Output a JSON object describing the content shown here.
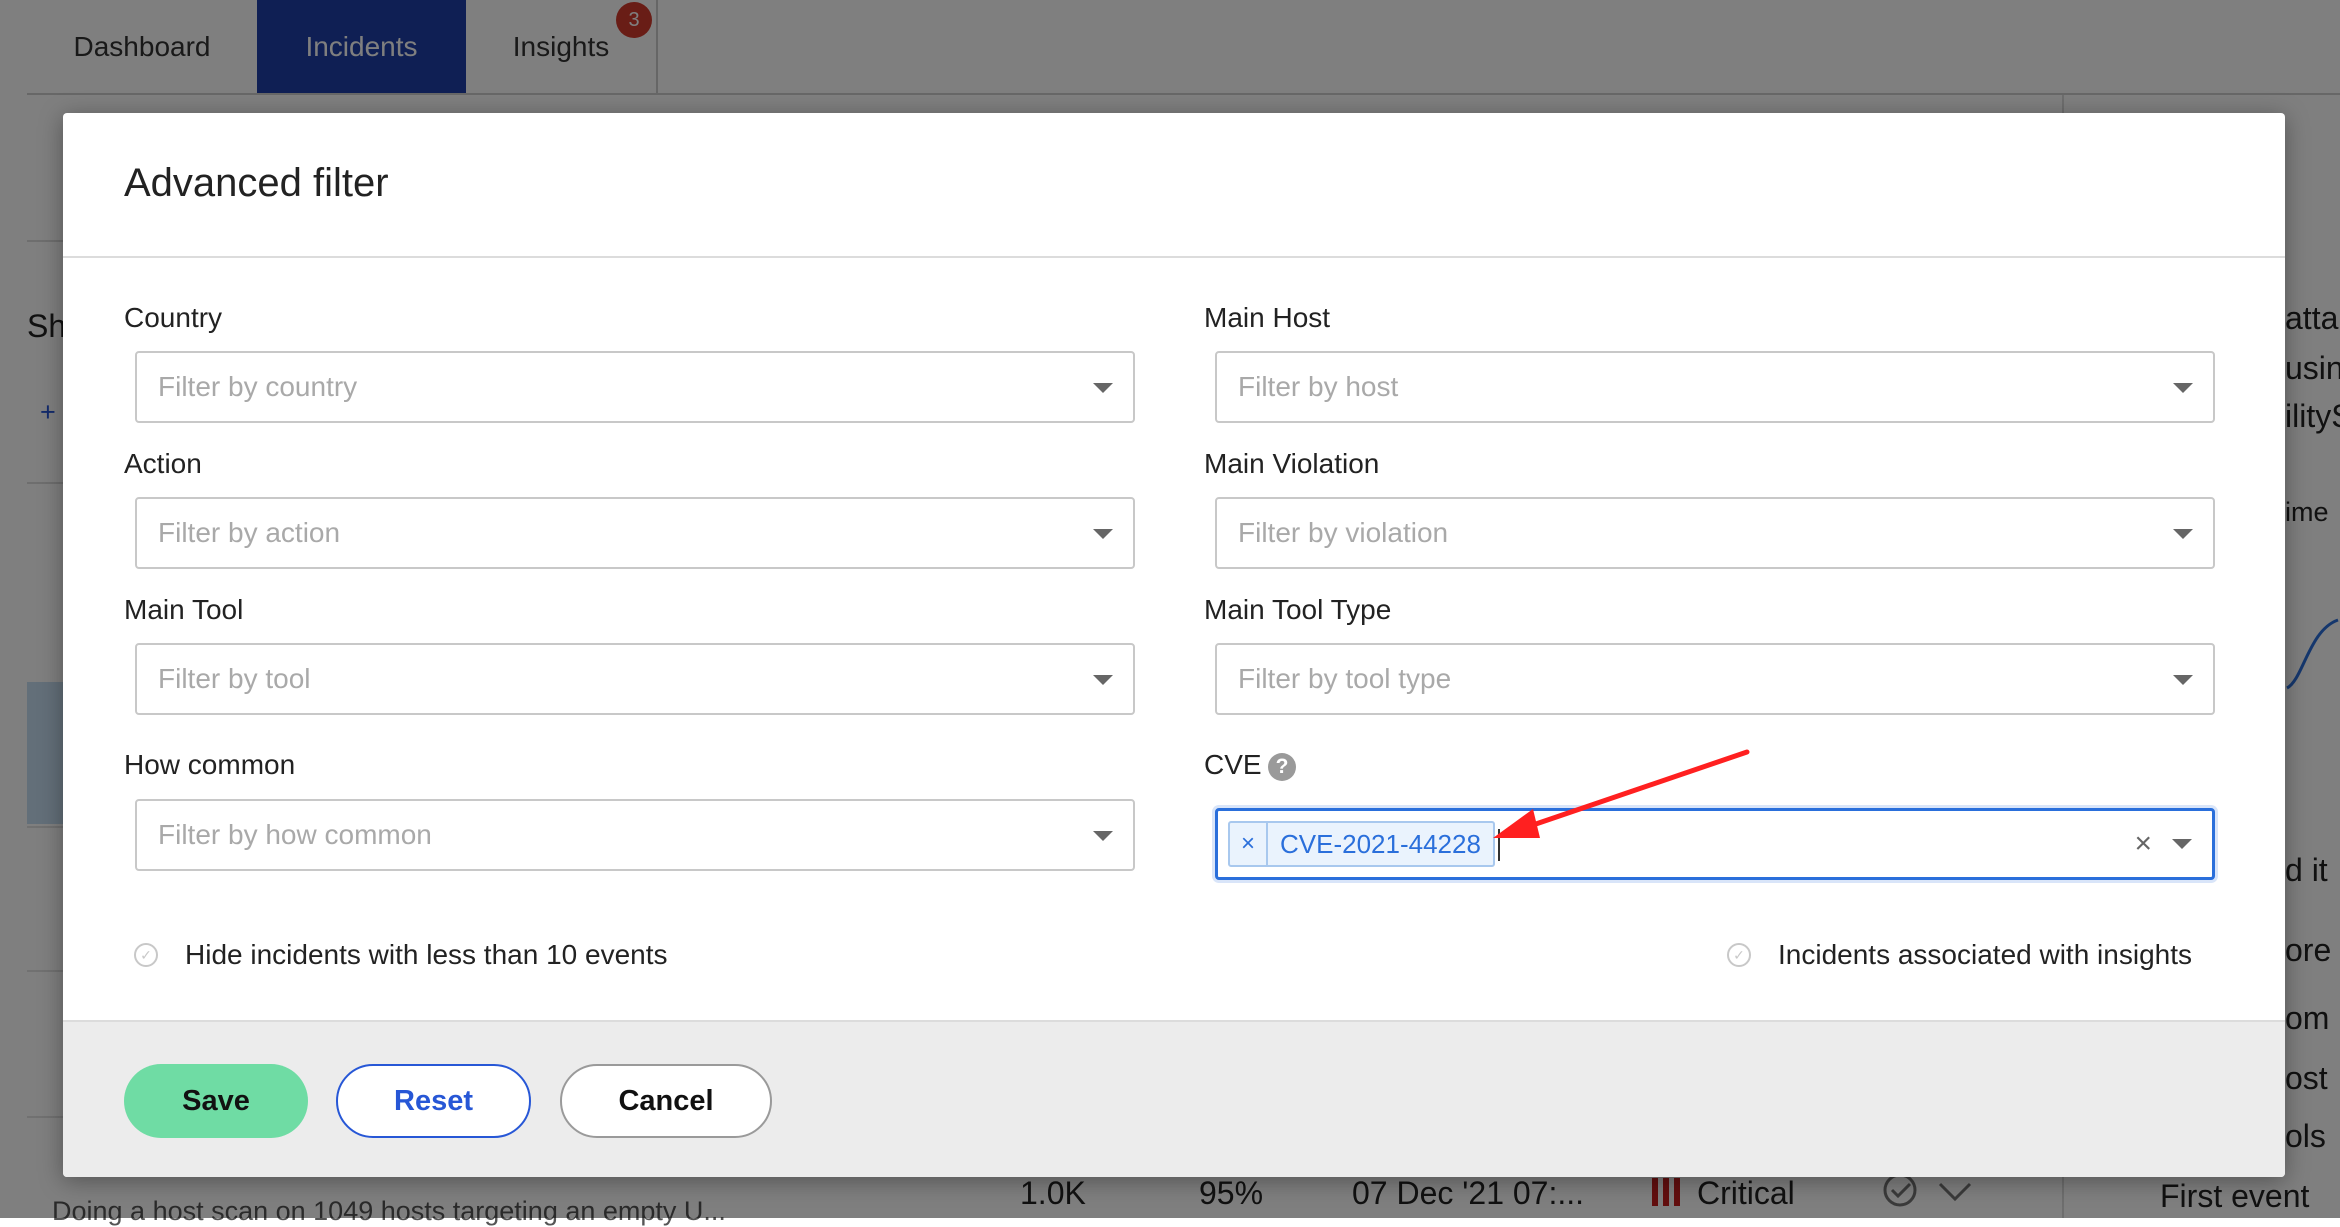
{
  "tabs": {
    "dashboard": "Dashboard",
    "incidents": "Incidents",
    "insights": "Insights",
    "insights_badge": "3"
  },
  "background": {
    "row_values": [
      "1.0K",
      "95%",
      "07 Dec '21 07:...",
      "Critical"
    ],
    "row_description": "Doing a host scan on 1049 hosts targeting an empty U...",
    "side_fragments": [
      "atta",
      "usin",
      "ilityS",
      "ime",
      "d it",
      "ore",
      "om",
      "ost",
      "ols"
    ],
    "side_first_event": "First event",
    "left_fragments": [
      "Sh",
      "+"
    ]
  },
  "modal": {
    "title": "Advanced filter",
    "fields": {
      "country": {
        "label": "Country",
        "placeholder": "Filter by country"
      },
      "action": {
        "label": "Action",
        "placeholder": "Filter by action"
      },
      "main_tool": {
        "label": "Main Tool",
        "placeholder": "Filter by tool"
      },
      "how_common": {
        "label": "How common",
        "placeholder": "Filter by how common"
      },
      "main_host": {
        "label": "Main Host",
        "placeholder": "Filter by host"
      },
      "main_violation": {
        "label": "Main Violation",
        "placeholder": "Filter by violation"
      },
      "main_tool_type": {
        "label": "Main Tool Type",
        "placeholder": "Filter by tool type"
      },
      "cve": {
        "label": "CVE",
        "help": "?",
        "chip": "CVE-2021-44228",
        "chip_remove": "×",
        "clear": "×"
      }
    },
    "checkboxes": {
      "hide_small": "Hide incidents with less than 10 events",
      "with_insights": "Incidents associated with insights"
    },
    "buttons": {
      "save": "Save",
      "reset": "Reset",
      "cancel": "Cancel"
    }
  },
  "colors": {
    "incidents_tab": "#1f3fa8",
    "badge": "#d33a2c",
    "focus": "#2a6fdb",
    "save": "#6fdca4",
    "reset": "#2757d6",
    "annotation_arrow": "#ff2020",
    "critical": "#c61f1f"
  }
}
